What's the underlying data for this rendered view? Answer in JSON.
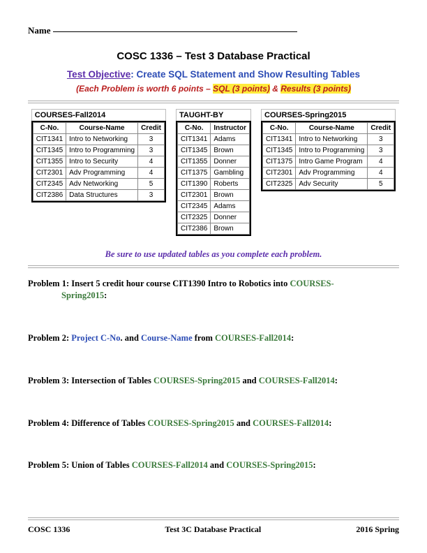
{
  "header": {
    "name_label": "Name"
  },
  "title": "COSC 1336 – Test 3 Database Practical",
  "objective": {
    "label": "Test Objective",
    "text": ": Create SQL Statement and Show Resulting Tables"
  },
  "scoring": {
    "prefix": "(Each Problem is worth 6 points – ",
    "sql": "SQL (3 points)",
    "amp": " & ",
    "res": "Results (3 points)",
    "suffix": ""
  },
  "tables": {
    "fall2014": {
      "title": "COURSES-Fall2014",
      "headers": [
        "C-No.",
        "Course-Name",
        "Credit"
      ],
      "rows": [
        [
          "CIT1341",
          "Intro to Networking",
          "3"
        ],
        [
          "CIT1345",
          "Intro to Programming",
          "3"
        ],
        [
          "CIT1355",
          "Intro to Security",
          "4"
        ],
        [
          "CIT2301",
          "Adv Programming",
          "4"
        ],
        [
          "CIT2345",
          "Adv Networking",
          "5"
        ],
        [
          "CIT2386",
          "Data Structures",
          "3"
        ]
      ]
    },
    "taughtby": {
      "title": "TAUGHT-BY",
      "headers": [
        "C-No.",
        "Instructor"
      ],
      "rows": [
        [
          "CIT1341",
          "Adams"
        ],
        [
          "CIT1345",
          "Brown"
        ],
        [
          "CIT1355",
          "Donner"
        ],
        [
          "CIT1375",
          "Gambling"
        ],
        [
          "CIT1390",
          "Roberts"
        ],
        [
          "CIT2301",
          "Brown"
        ],
        [
          "CIT2345",
          "Adams"
        ],
        [
          "CIT2325",
          "Donner"
        ],
        [
          "CIT2386",
          "Brown"
        ]
      ]
    },
    "spring2015": {
      "title": "COURSES-Spring2015",
      "headers": [
        "C-No.",
        "Course-Name",
        "Credit"
      ],
      "rows": [
        [
          "CIT1341",
          "Intro to Networking",
          "3"
        ],
        [
          "CIT1345",
          "Intro to Programming",
          "3"
        ],
        [
          "CIT1375",
          "Intro Game Program",
          "4"
        ],
        [
          "CIT2301",
          "Adv Programming",
          "4"
        ],
        [
          "CIT2325",
          "Adv Security",
          "5"
        ]
      ]
    }
  },
  "note": "Be sure to use updated tables as you complete each problem.",
  "problems": {
    "p1": {
      "lead": "Problem 1: Insert 5 credit hour course CIT1390 Intro to Robotics into ",
      "green1": "COURSES-",
      "green2": "Spring2015",
      "tail": ":"
    },
    "p2": {
      "lead": "Problem 2:  ",
      "blue1": "Project C-No",
      "mid1": ". and ",
      "blue2": "Course-Name",
      "mid2": " from ",
      "green": "COURSES-Fall2014",
      "tail": ":"
    },
    "p3": {
      "lead": "Problem 3:  Intersection of Tables ",
      "g1": "COURSES-Spring2015",
      "and": " and ",
      "g2": "COURSES-Fall2014",
      "tail": ":"
    },
    "p4": {
      "lead": "Problem 4:  Difference of Tables ",
      "g1": "COURSES-Spring2015",
      "and": " and ",
      "g2": "COURSES-Fall2014",
      "tail": ":"
    },
    "p5": {
      "lead": "Problem 5:  Union of Tables ",
      "g1": "COURSES-Fall2014",
      "and": " and ",
      "g2": "COURSES-Spring2015",
      "tail": ":"
    }
  },
  "footer": {
    "left": "COSC 1336",
    "center": "Test 3C Database Practical",
    "right": "2016 Spring"
  }
}
